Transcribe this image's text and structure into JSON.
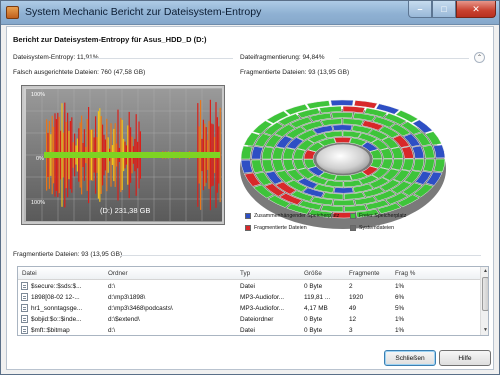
{
  "window": {
    "title": "System Mechanic Bericht zur Dateisystem-Entropy",
    "minimize_glyph": "–",
    "maximize_glyph": "□",
    "close_glyph": "✕"
  },
  "report": {
    "title": "Bericht zur Dateisystem-Entropy für Asus_HDD_D (D:)",
    "entropy_label": "Dateisystem-Entropy: 11,91%",
    "fragmentation_label": "Dateifragmentierung: 94,84%",
    "misaligned_label": "Falsch ausgerichtete Dateien: 760 (47,58 GB)",
    "fragmented_files_label": "Fragmentierte Dateien: 93 (13,95 GB)",
    "collapse_glyph": "⌃"
  },
  "graph": {
    "tick_top": "100%",
    "tick_mid": "0%",
    "tick_bottom": "100%",
    "drive_label": "(D:) 231,38 GB"
  },
  "legend": {
    "contiguous": "Zusammenhängender Speicherplatz",
    "free": "Freier Speicherplatz",
    "fragmented": "Fragmentierte Dateien",
    "system": "Systemdateien",
    "colors": {
      "contiguous": "#2e4fc4",
      "free": "#3ec43a",
      "fragmented": "#d8282a",
      "system": "#6c6c6c"
    }
  },
  "table": {
    "section_label": "Fragmentierte Dateien: 93 (13,95 GB)",
    "headers": {
      "file": "Datei",
      "folder": "Ordner",
      "type": "Typ",
      "size": "Größe",
      "fragments": "Fragmente",
      "frag": "Frag %"
    },
    "rows": [
      {
        "file": "$secure::$sds:$...",
        "folder": "d:\\",
        "type": "Datei",
        "size": "0 Byte",
        "fragments": "2",
        "frag": "1%"
      },
      {
        "file": "1898[08-02 12-...",
        "folder": "d:\\mp3\\1898\\",
        "type": "MP3-Audiofor...",
        "size": "119,81 ...",
        "fragments": "1920",
        "frag": "6%"
      },
      {
        "file": "hr1_sonntagsge...",
        "folder": "d:\\mp3\\3468\\podcasts\\",
        "type": "MP3-Audiofor...",
        "size": "4,17 MB",
        "fragments": "49",
        "frag": "5%"
      },
      {
        "file": "$objid:$o::$inde...",
        "folder": "d:\\$extend\\",
        "type": "Dateiordner",
        "size": "0 Byte",
        "fragments": "12",
        "frag": "1%"
      },
      {
        "file": "$mft::$bitmap",
        "folder": "d:\\",
        "type": "Datei",
        "size": "0 Byte",
        "fragments": "3",
        "frag": "1%"
      }
    ]
  },
  "buttons": {
    "close": "Schließen",
    "help": "Hilfe"
  }
}
